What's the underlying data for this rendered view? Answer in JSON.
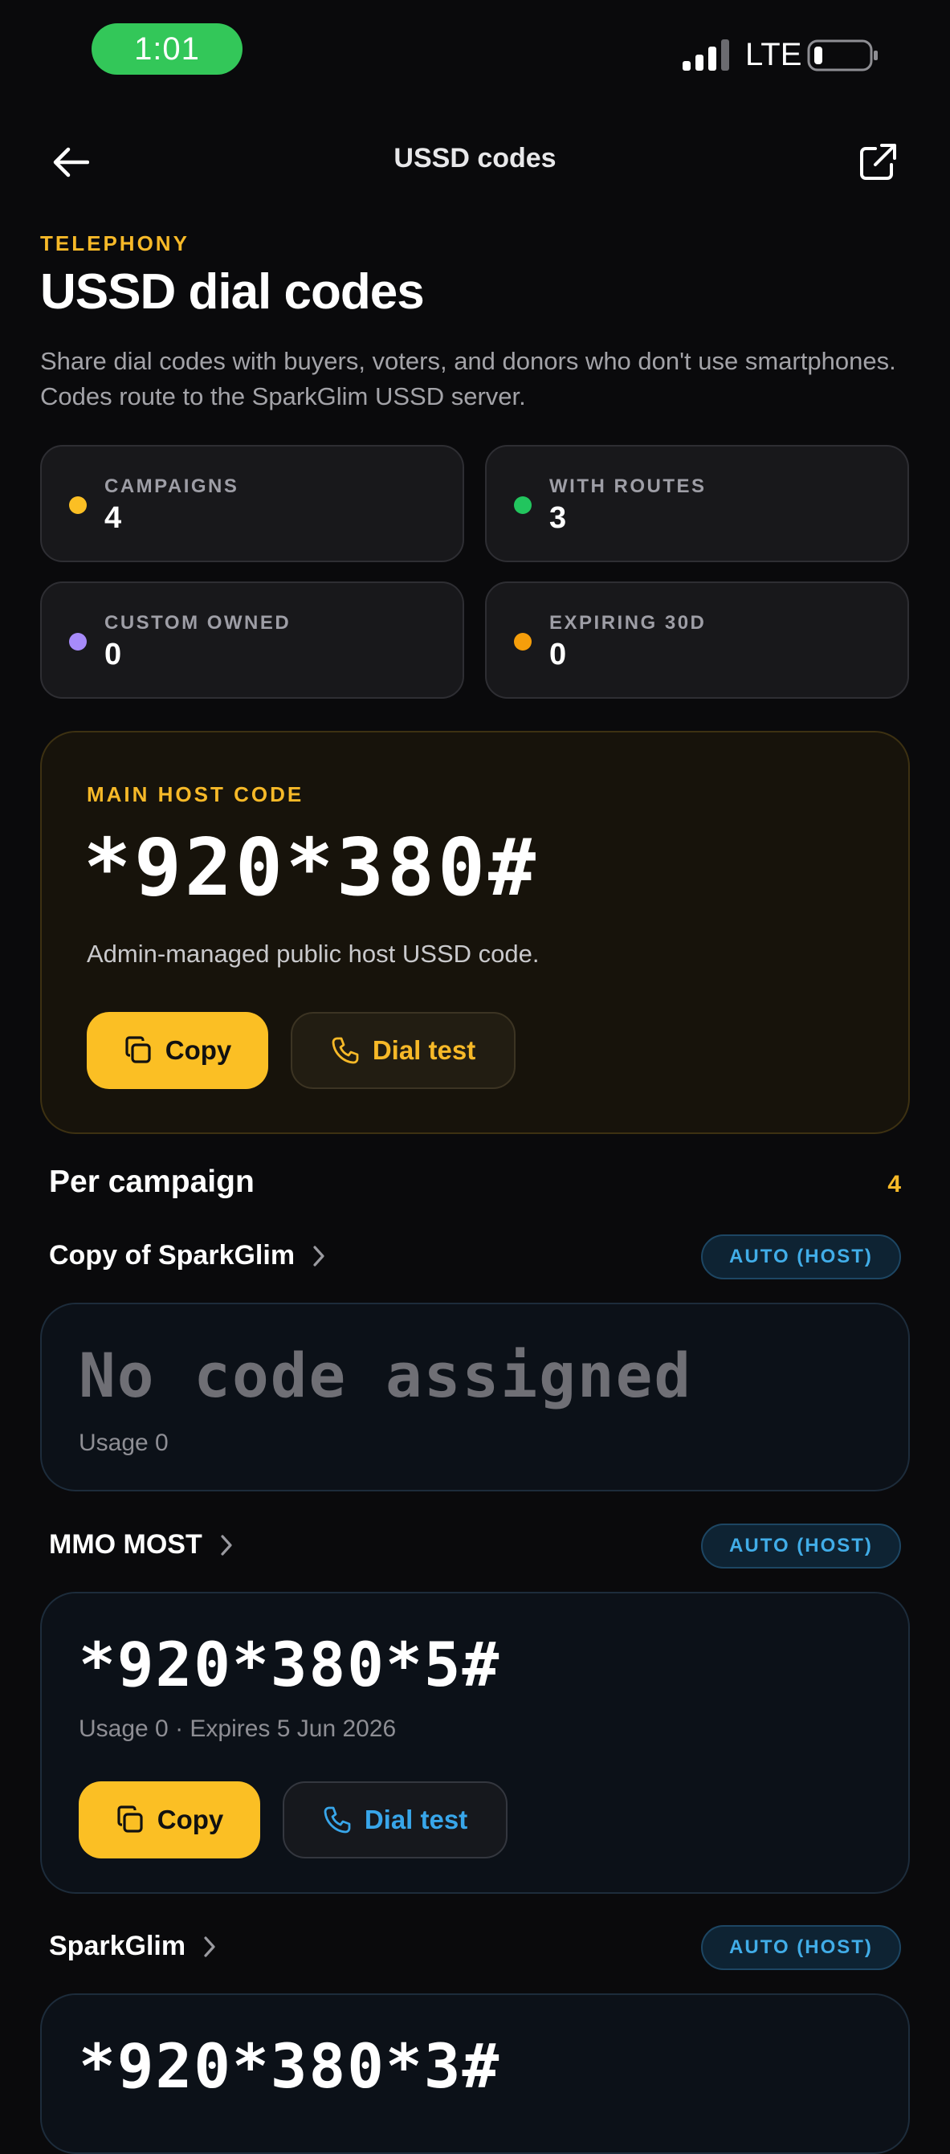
{
  "status_bar": {
    "time": "1:01",
    "network": "LTE",
    "icons": [
      "signal-icon",
      "battery-icon"
    ]
  },
  "nav": {
    "title": "USSD codes",
    "icons": [
      "back-arrow-icon",
      "external-link-icon"
    ]
  },
  "header": {
    "eyebrow": "TELEPHONY",
    "title": "USSD dial codes",
    "description": "Share dial codes with buyers, voters, and donors who don't use smartphones. Codes route to the SparkGlim USSD server."
  },
  "stats": [
    {
      "label": "CAMPAIGNS",
      "value": "4",
      "dot_color": "#fbbf24"
    },
    {
      "label": "WITH ROUTES",
      "value": "3",
      "dot_color": "#22c55e"
    },
    {
      "label": "CUSTOM OWNED",
      "value": "0",
      "dot_color": "#a78bfa"
    },
    {
      "label": "EXPIRING 30D",
      "value": "0",
      "dot_color": "#f59e0b"
    }
  ],
  "host": {
    "eyebrow": "MAIN HOST CODE",
    "code": "*920*380#",
    "description": "Admin-managed public host USSD code.",
    "copy_label": "Copy",
    "dial_label": "Dial test"
  },
  "campaigns_section": {
    "title": "Per campaign",
    "count": "4"
  },
  "campaigns": [
    {
      "name": "Copy of SparkGlim",
      "badge": "AUTO (HOST)",
      "code": "No code assigned",
      "meta": "Usage 0"
    },
    {
      "name": "MMO MOST",
      "badge": "AUTO (HOST)",
      "code": "*920*380*5#",
      "meta": "Usage 0 · Expires 5 Jun 2026",
      "copy_label": "Copy",
      "dial_label": "Dial test"
    },
    {
      "name": "SparkGlim",
      "badge": "AUTO (HOST)",
      "code": "*920*380*3#"
    }
  ],
  "colors": {
    "background": "#0a0a0c",
    "accent": "#fbbf24",
    "link_blue": "#38a6ea",
    "status_green": "#33c759"
  }
}
